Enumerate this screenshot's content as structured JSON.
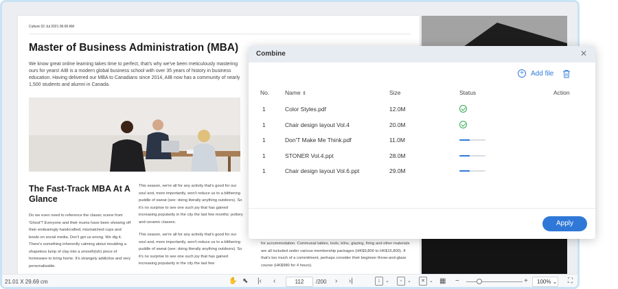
{
  "document": {
    "dateline": "Culture 02 Jul 2021 06:00 AM",
    "title": "Master of Business Administration (MBA)",
    "intro": "We know great online learning takes time to perfect, that's why we've been meticulously mastering ours for years! AIB is a modern global business school with over 35 years of history in business education. Having delivered our MBA to Canadians since 2014, AIB now has a community of nearly 1,500 students and alumni in Canada.",
    "subtitle": "The Fast-Track MBA At A Glance",
    "col_left": "Do we even need to reference the classic scene from 'Ghost'? Everyone and their mums have been showing off their endearingly handcrafted, mismatched cups and bowls on social media. Don't get us wrong. We dig it. There's something inherently calming about moulding a shapeless lump of clay into a smooth(ish) piece of homeware to bring home. It's strangely addictive and very personalisable.",
    "col_mid_1": "This season, we're all for any activity that's good for our soul and, more importantly, won't reduce us to a blithering puddle of sweat (see: doing literally anything outdoors). So it's no surprise to see one such joy that has gained increasing popularity in the city the last few months: pottery and ceramic classes.",
    "col_mid_2": "This season, we're all for any activity that's good for our soul and, more importantly, won't reduce us to a blithering puddle of sweat (see: doing literally anything outdoors). So it's no surprise to see one such joy that has gained increasing popularity in the city the last few",
    "col_right_bottom": "for accommodation. Communal tables, tools, kilns, glazing, firing and other materials are all included under various membership packages (HK$9,800 to HK$15,800). If that's too much of a commitment, perhaps consider their beginner throw-and-glaze course (HK$980 for 4 hours)."
  },
  "statusbar": {
    "page_dimensions": "21.01 X 29.69 cm",
    "current_page": "112",
    "total_pages": "/200",
    "zoom": "100%"
  },
  "dialog": {
    "title": "Combine",
    "add_file_label": "Add file",
    "columns": {
      "no": "No.",
      "name": "Name",
      "size": "Size",
      "status": "Status",
      "action": "Action"
    },
    "files": [
      {
        "no": "1",
        "name": "Color Styles.pdf",
        "size": "12.0M",
        "status": "done",
        "progress": 1.0
      },
      {
        "no": "1",
        "name": "Chair design layout Vol.4",
        "size": "20.0M",
        "status": "done",
        "progress": 1.0
      },
      {
        "no": "1",
        "name": "Don'T Make Me Think.pdf",
        "size": "11.0M",
        "status": "in-progress",
        "progress": 0.4
      },
      {
        "no": "1",
        "name": "STONER Vol.4.ppt",
        "size": "28.0M",
        "status": "in-progress",
        "progress": 0.4
      },
      {
        "no": "1",
        "name": "Chair design layout Vol.6.ppt",
        "size": "29.0M",
        "status": "in-progress",
        "progress": 0.4
      }
    ],
    "apply_label": "Apply"
  },
  "colors": {
    "accent": "#2f78d8",
    "success": "#2fa84f",
    "dialog_header": "#e7ecf2"
  }
}
